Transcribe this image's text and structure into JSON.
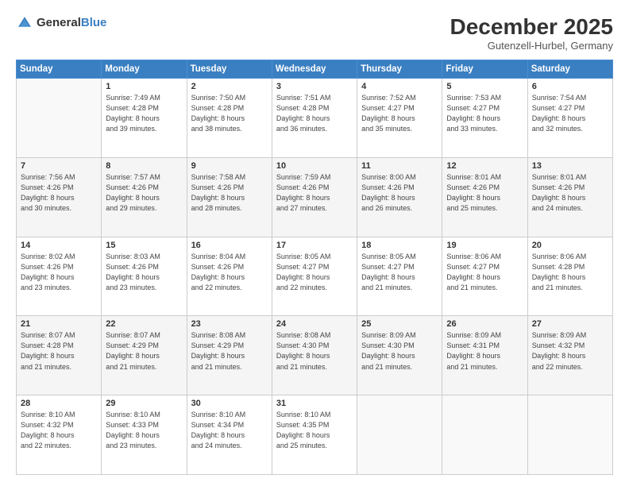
{
  "header": {
    "logo_general": "General",
    "logo_blue": "Blue",
    "month": "December 2025",
    "location": "Gutenzell-Hurbel, Germany"
  },
  "days_of_week": [
    "Sunday",
    "Monday",
    "Tuesday",
    "Wednesday",
    "Thursday",
    "Friday",
    "Saturday"
  ],
  "weeks": [
    [
      {
        "day": "",
        "info": ""
      },
      {
        "day": "1",
        "info": "Sunrise: 7:49 AM\nSunset: 4:28 PM\nDaylight: 8 hours\nand 39 minutes."
      },
      {
        "day": "2",
        "info": "Sunrise: 7:50 AM\nSunset: 4:28 PM\nDaylight: 8 hours\nand 38 minutes."
      },
      {
        "day": "3",
        "info": "Sunrise: 7:51 AM\nSunset: 4:28 PM\nDaylight: 8 hours\nand 36 minutes."
      },
      {
        "day": "4",
        "info": "Sunrise: 7:52 AM\nSunset: 4:27 PM\nDaylight: 8 hours\nand 35 minutes."
      },
      {
        "day": "5",
        "info": "Sunrise: 7:53 AM\nSunset: 4:27 PM\nDaylight: 8 hours\nand 33 minutes."
      },
      {
        "day": "6",
        "info": "Sunrise: 7:54 AM\nSunset: 4:27 PM\nDaylight: 8 hours\nand 32 minutes."
      }
    ],
    [
      {
        "day": "7",
        "info": "Sunrise: 7:56 AM\nSunset: 4:26 PM\nDaylight: 8 hours\nand 30 minutes."
      },
      {
        "day": "8",
        "info": "Sunrise: 7:57 AM\nSunset: 4:26 PM\nDaylight: 8 hours\nand 29 minutes."
      },
      {
        "day": "9",
        "info": "Sunrise: 7:58 AM\nSunset: 4:26 PM\nDaylight: 8 hours\nand 28 minutes."
      },
      {
        "day": "10",
        "info": "Sunrise: 7:59 AM\nSunset: 4:26 PM\nDaylight: 8 hours\nand 27 minutes."
      },
      {
        "day": "11",
        "info": "Sunrise: 8:00 AM\nSunset: 4:26 PM\nDaylight: 8 hours\nand 26 minutes."
      },
      {
        "day": "12",
        "info": "Sunrise: 8:01 AM\nSunset: 4:26 PM\nDaylight: 8 hours\nand 25 minutes."
      },
      {
        "day": "13",
        "info": "Sunrise: 8:01 AM\nSunset: 4:26 PM\nDaylight: 8 hours\nand 24 minutes."
      }
    ],
    [
      {
        "day": "14",
        "info": "Sunrise: 8:02 AM\nSunset: 4:26 PM\nDaylight: 8 hours\nand 23 minutes."
      },
      {
        "day": "15",
        "info": "Sunrise: 8:03 AM\nSunset: 4:26 PM\nDaylight: 8 hours\nand 23 minutes."
      },
      {
        "day": "16",
        "info": "Sunrise: 8:04 AM\nSunset: 4:26 PM\nDaylight: 8 hours\nand 22 minutes."
      },
      {
        "day": "17",
        "info": "Sunrise: 8:05 AM\nSunset: 4:27 PM\nDaylight: 8 hours\nand 22 minutes."
      },
      {
        "day": "18",
        "info": "Sunrise: 8:05 AM\nSunset: 4:27 PM\nDaylight: 8 hours\nand 21 minutes."
      },
      {
        "day": "19",
        "info": "Sunrise: 8:06 AM\nSunset: 4:27 PM\nDaylight: 8 hours\nand 21 minutes."
      },
      {
        "day": "20",
        "info": "Sunrise: 8:06 AM\nSunset: 4:28 PM\nDaylight: 8 hours\nand 21 minutes."
      }
    ],
    [
      {
        "day": "21",
        "info": "Sunrise: 8:07 AM\nSunset: 4:28 PM\nDaylight: 8 hours\nand 21 minutes."
      },
      {
        "day": "22",
        "info": "Sunrise: 8:07 AM\nSunset: 4:29 PM\nDaylight: 8 hours\nand 21 minutes."
      },
      {
        "day": "23",
        "info": "Sunrise: 8:08 AM\nSunset: 4:29 PM\nDaylight: 8 hours\nand 21 minutes."
      },
      {
        "day": "24",
        "info": "Sunrise: 8:08 AM\nSunset: 4:30 PM\nDaylight: 8 hours\nand 21 minutes."
      },
      {
        "day": "25",
        "info": "Sunrise: 8:09 AM\nSunset: 4:30 PM\nDaylight: 8 hours\nand 21 minutes."
      },
      {
        "day": "26",
        "info": "Sunrise: 8:09 AM\nSunset: 4:31 PM\nDaylight: 8 hours\nand 21 minutes."
      },
      {
        "day": "27",
        "info": "Sunrise: 8:09 AM\nSunset: 4:32 PM\nDaylight: 8 hours\nand 22 minutes."
      }
    ],
    [
      {
        "day": "28",
        "info": "Sunrise: 8:10 AM\nSunset: 4:32 PM\nDaylight: 8 hours\nand 22 minutes."
      },
      {
        "day": "29",
        "info": "Sunrise: 8:10 AM\nSunset: 4:33 PM\nDaylight: 8 hours\nand 23 minutes."
      },
      {
        "day": "30",
        "info": "Sunrise: 8:10 AM\nSunset: 4:34 PM\nDaylight: 8 hours\nand 24 minutes."
      },
      {
        "day": "31",
        "info": "Sunrise: 8:10 AM\nSunset: 4:35 PM\nDaylight: 8 hours\nand 25 minutes."
      },
      {
        "day": "",
        "info": ""
      },
      {
        "day": "",
        "info": ""
      },
      {
        "day": "",
        "info": ""
      }
    ]
  ]
}
